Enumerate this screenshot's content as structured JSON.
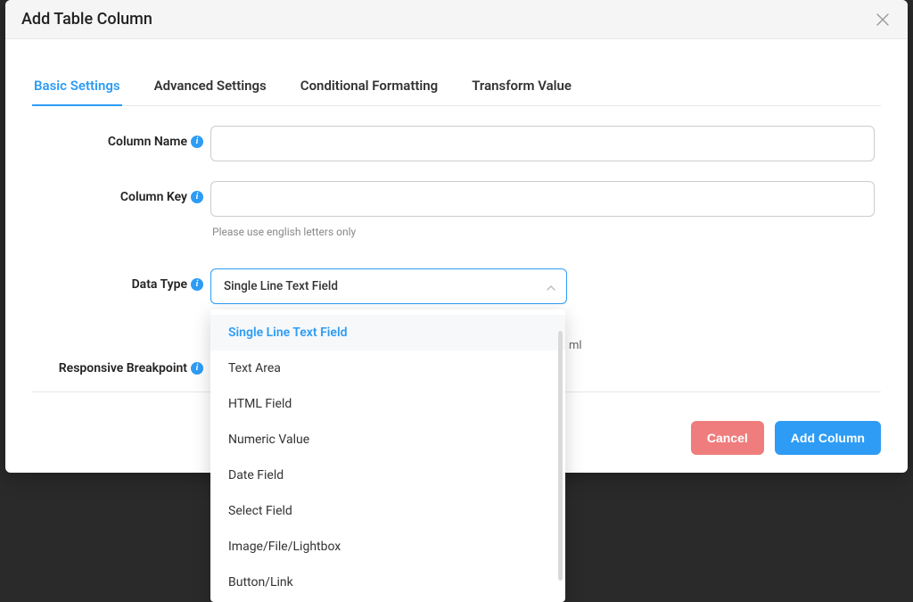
{
  "modal": {
    "title": "Add Table Column",
    "tabs": [
      {
        "label": "Basic Settings",
        "active": true
      },
      {
        "label": "Advanced Settings",
        "active": false
      },
      {
        "label": "Conditional Formatting",
        "active": false
      },
      {
        "label": "Transform Value",
        "active": false
      }
    ],
    "fields": {
      "column_name": {
        "label": "Column Name",
        "value": ""
      },
      "column_key": {
        "label": "Column Key",
        "value": "",
        "helper": "Please use english letters only"
      },
      "data_type": {
        "label": "Data Type",
        "selected": "Single Line Text Field",
        "side_hint_suffix": "ml",
        "options": [
          "Single Line Text Field",
          "Text Area",
          "HTML Field",
          "Numeric Value",
          "Date Field",
          "Select Field",
          "Image/File/Lightbox",
          "Button/Link"
        ]
      },
      "responsive_breakpoint": {
        "label": "Responsive Breakpoint"
      }
    },
    "buttons": {
      "cancel": "Cancel",
      "add": "Add Column"
    }
  },
  "colors": {
    "accent": "#2e9cf5",
    "danger": "#ef7d7d"
  }
}
